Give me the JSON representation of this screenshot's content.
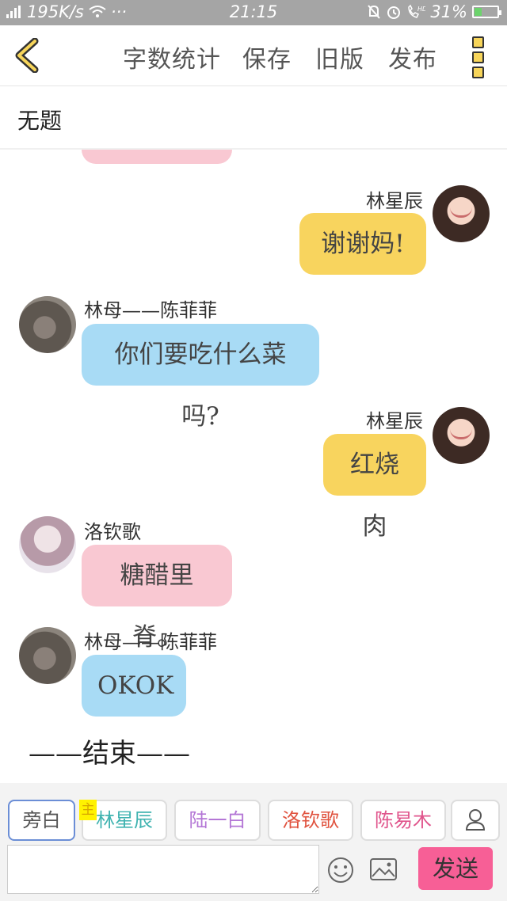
{
  "status_bar": {
    "network": "4G",
    "speed": "195K/s",
    "more": "···",
    "time": "21:15",
    "hd": "HD",
    "battery_percent_text": "31%",
    "battery_level": 0.31
  },
  "toolbar": {
    "word_count": "字数统计",
    "save": "保存",
    "old_version": "旧版",
    "publish": "发布",
    "accent_color": "#f7d55a"
  },
  "document": {
    "title": "无题"
  },
  "messages": [
    {
      "speaker": "林星辰",
      "text": "谢谢妈!",
      "side": "right",
      "color": "#f8d45e"
    },
    {
      "speaker": "林母——陈菲菲",
      "text": "你们要吃什么菜吗?",
      "side": "left",
      "color": "#a8dbf5"
    },
    {
      "speaker": "林星辰",
      "text": "红烧肉",
      "side": "right",
      "color": "#f8d45e"
    },
    {
      "speaker": "洛钦歌",
      "text": "糖醋里脊。",
      "side": "left",
      "color": "#f9c8d2"
    },
    {
      "speaker": "林母——陈菲菲",
      "text": "OKOK",
      "side": "left",
      "color": "#a8dbf5"
    }
  ],
  "end_text": "——结束——",
  "roles": [
    {
      "label": "旁白",
      "color": "#555555"
    },
    {
      "label": "林星辰",
      "color": "#3fb3b0"
    },
    {
      "label": "陆一白",
      "color": "#b477d6"
    },
    {
      "label": "洛钦歌",
      "color": "#e0533f"
    },
    {
      "label": "陈易木",
      "color": "#e0558c"
    }
  ],
  "main_tag": "主",
  "composer": {
    "input_value": "",
    "send_label": "发送",
    "send_color": "#f75f96"
  }
}
